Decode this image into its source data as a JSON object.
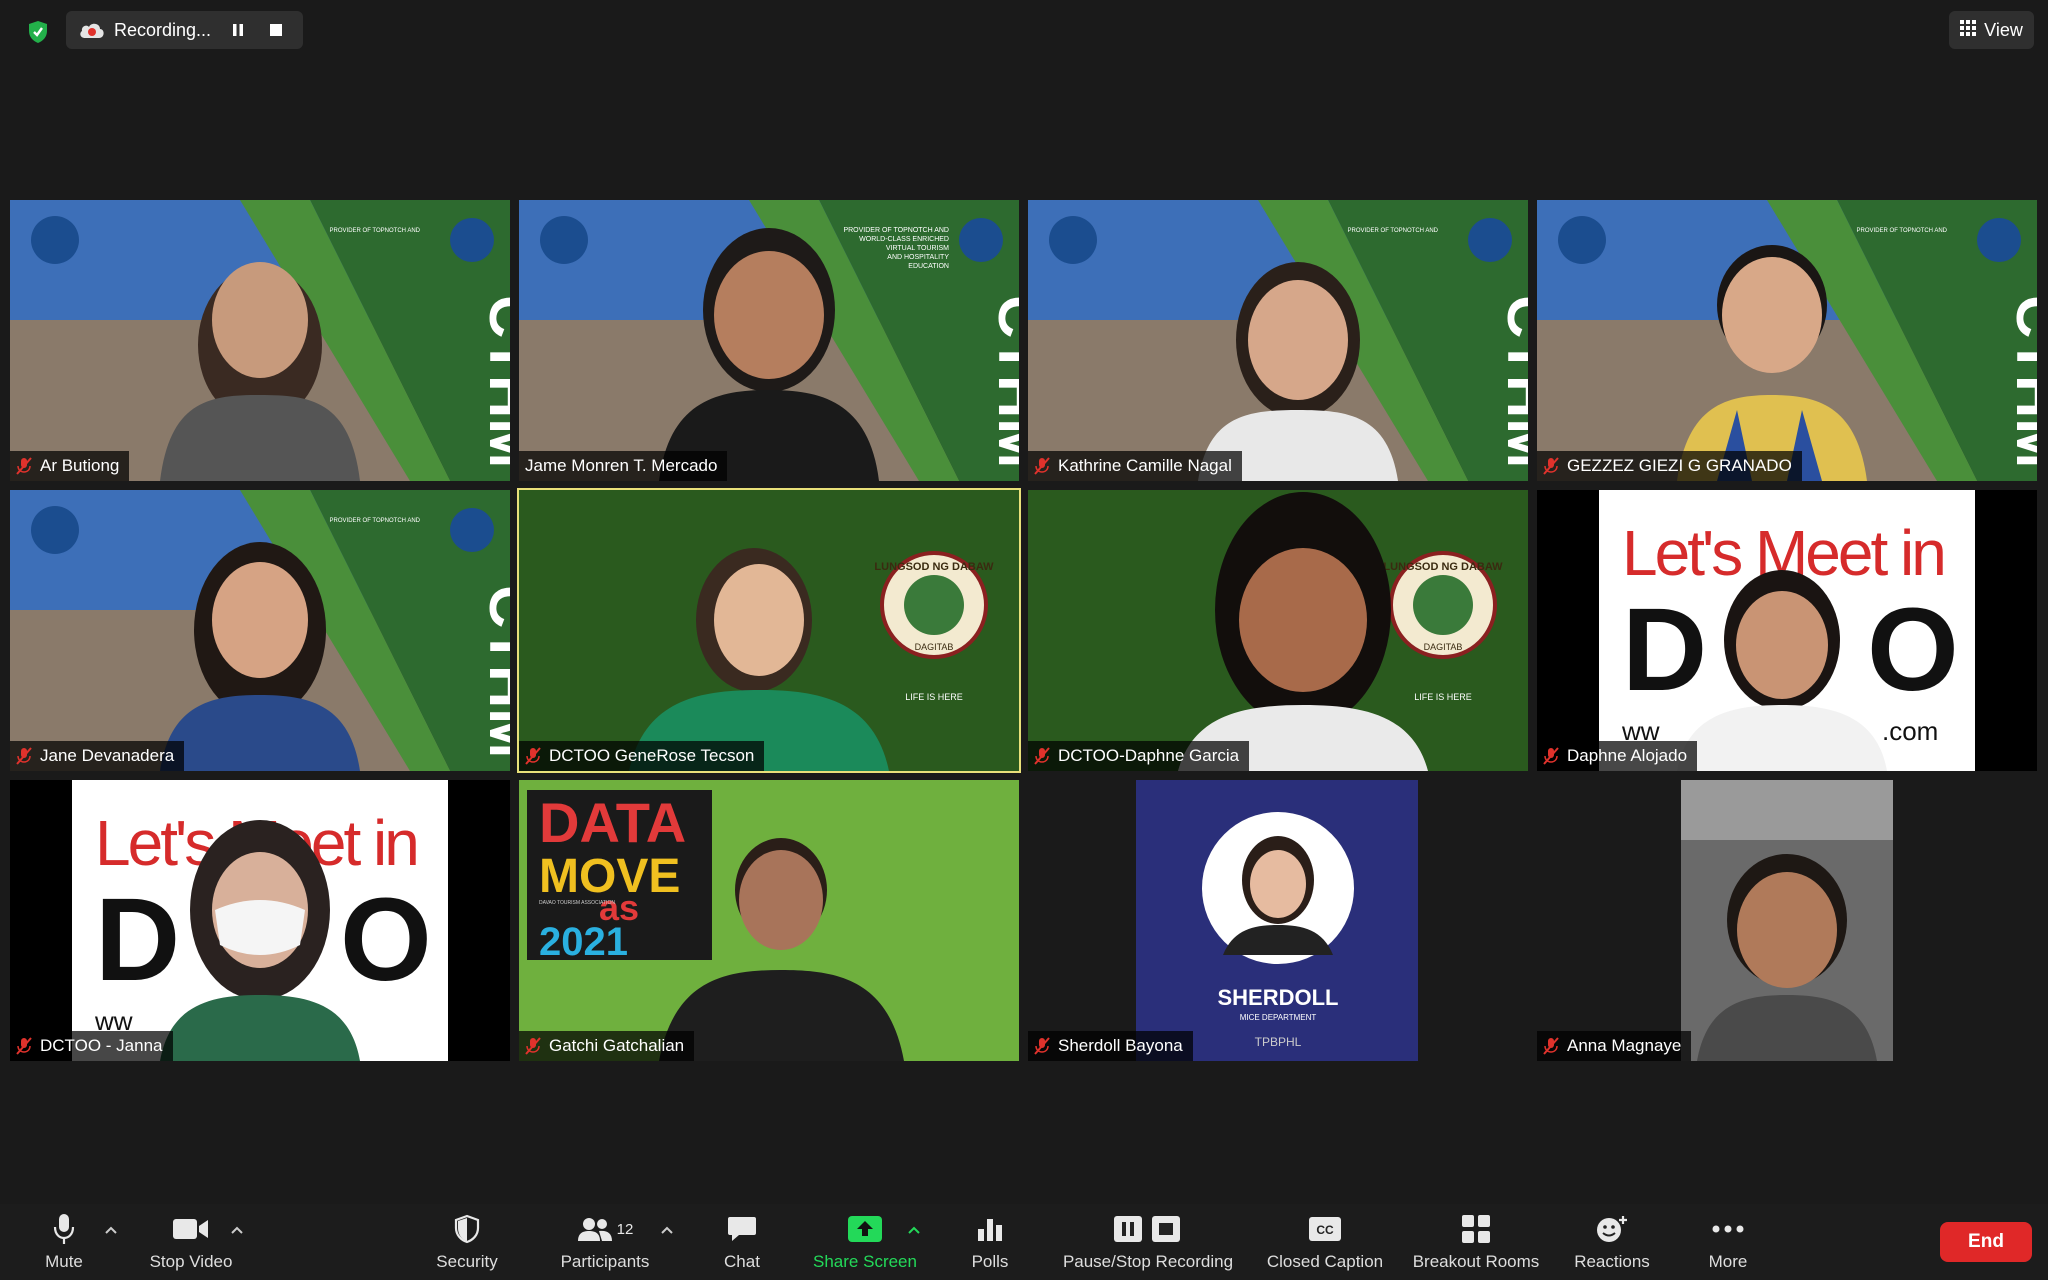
{
  "top_bar": {
    "recording_label": "Recording...",
    "view_label": "View"
  },
  "participants": [
    {
      "name": "Ar Butiong",
      "muted": true,
      "background": "CTHM"
    },
    {
      "name": "Jame Monren T. Mercado",
      "muted": false,
      "background": "CTHM"
    },
    {
      "name": "Kathrine Camille Nagal",
      "muted": true,
      "background": "CTHM"
    },
    {
      "name": "GEZZEZ GIEZI G GRANADO",
      "muted": true,
      "background": "CTHM"
    },
    {
      "name": "Jane Devanadera",
      "muted": true,
      "background": "CTHM"
    },
    {
      "name": "DCTOO GeneRose Tecson",
      "muted": true,
      "background": "Dabaw seal",
      "active_speaker": true
    },
    {
      "name": "DCTOO-Daphne Garcia",
      "muted": true,
      "background": "Dabaw seal"
    },
    {
      "name": "Daphne Alojado",
      "muted": true,
      "background": "Let's Meet in Davao"
    },
    {
      "name": "DCTOO - Janna",
      "muted": true,
      "background": "Let's Meet in Davao"
    },
    {
      "name": "Gatchi Gatchalian",
      "muted": true,
      "background": "DATA MOVE as 1 2021"
    },
    {
      "name": "Sherdoll Bayona",
      "muted": true,
      "background": "SHERDOLL"
    },
    {
      "name": "Anna Magnaye",
      "muted": true,
      "background": "car interior"
    }
  ],
  "backgrounds": {
    "cthm_word": "CTHM",
    "cthm_tagline": [
      "PROVIDER OF TOPNOTCH AND",
      "WORLD-CLASS ENRICHED",
      "VIRTUAL TOURISM",
      "AND HOSPITALITY",
      "EDUCATION"
    ],
    "seal_text": "LUNGSOD NG DABAW",
    "seal_sub": "DAGITAB",
    "seal_life": "LIFE IS HERE",
    "lets_meet": "Let's Meet in",
    "davao_url_left": "ww",
    "davao_url_right": ".com",
    "data_line1": "DATA",
    "data_line2": "MOVE",
    "data_line3": "as",
    "data_line4": "2021",
    "data_assoc": "DAVAO TOURISM ASSOCIATION",
    "sherdoll_name": "SHERDOLL",
    "sherdoll_dept": "MICE DEPARTMENT",
    "sherdoll_brand": "TPBPHL"
  },
  "toolbar": {
    "mute": "Mute",
    "stop_video": "Stop Video",
    "security": "Security",
    "participants": "Participants",
    "participants_count": "12",
    "chat": "Chat",
    "share_screen": "Share Screen",
    "polls": "Polls",
    "pause_stop_recording": "Pause/Stop Recording",
    "closed_caption": "Closed Caption",
    "breakout_rooms": "Breakout Rooms",
    "reactions": "Reactions",
    "more": "More",
    "end": "End"
  },
  "colors": {
    "background": "#1a1a1a",
    "share_green": "#23d959",
    "end_red": "#e02828",
    "active_speaker": "#e9e07a",
    "muted_red": "#e0322c"
  }
}
